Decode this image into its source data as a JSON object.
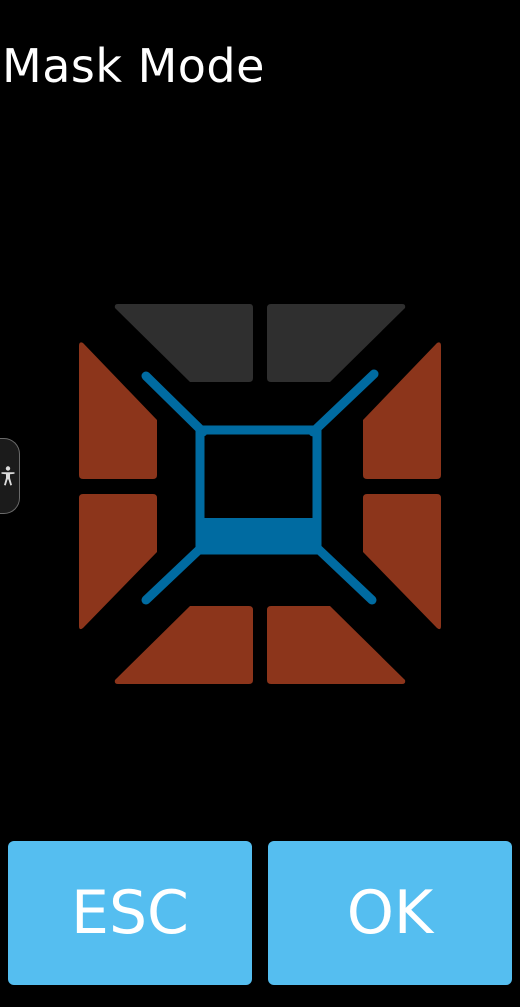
{
  "header": {
    "title": "Mask Mode"
  },
  "mask": {
    "segments": {
      "top_left": "inactive",
      "top_right": "inactive",
      "right_top": "active",
      "right_bottom": "active",
      "bottom_right": "active",
      "bottom_left": "active",
      "left_bottom": "active",
      "left_top": "active"
    },
    "colors": {
      "inactive": "#2f2f2f",
      "active": "#8c351b",
      "frame": "#006ba1"
    }
  },
  "side_handle": {
    "icon": "accessibility-icon"
  },
  "buttons": {
    "esc_label": "ESC",
    "ok_label": "OK",
    "color": "#55bef0"
  }
}
